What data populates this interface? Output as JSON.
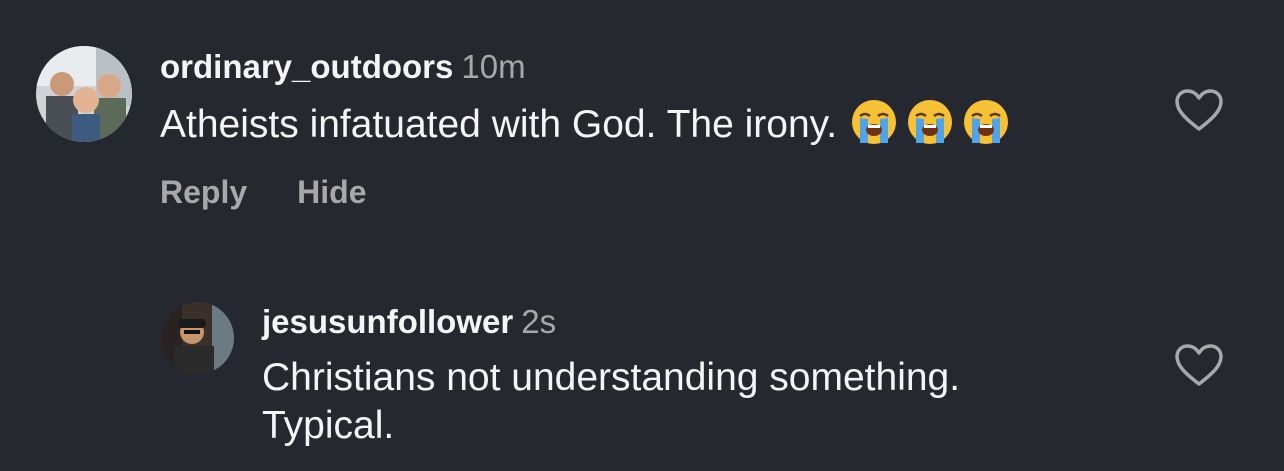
{
  "comments": [
    {
      "username": "ordinary_outdoors",
      "time": "10m",
      "text": "Atheists infatuated with God. The irony.",
      "emojis": [
        "loudly-crying-face",
        "loudly-crying-face",
        "loudly-crying-face"
      ],
      "actions": {
        "reply": "Reply",
        "hide": "Hide"
      }
    },
    {
      "username": "jesusunfollower",
      "time": "2s",
      "text_line1": "Christians not understanding something.",
      "text_line2": "Typical."
    }
  ],
  "icons": {
    "like": "heart-outline-icon"
  },
  "colors": {
    "background": "#262830",
    "primary_text": "#f5f5f5",
    "secondary_text": "#a8a8a8"
  }
}
